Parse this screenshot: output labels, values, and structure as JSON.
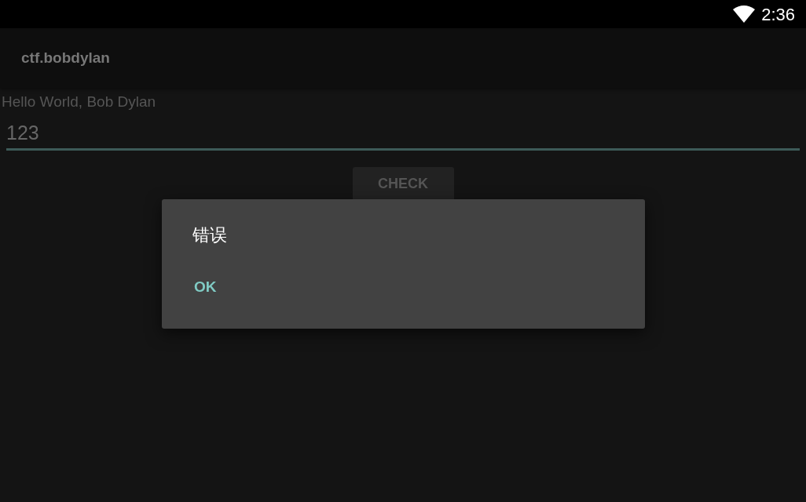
{
  "status_bar": {
    "time": "2:36"
  },
  "app_bar": {
    "title": "ctf.bobdylan"
  },
  "content": {
    "greeting": "Hello World, Bob Dylan",
    "input": {
      "value": "123"
    },
    "check_button": {
      "label": "CHECK"
    }
  },
  "dialog": {
    "title": "错误",
    "buttons": [
      "OK"
    ]
  }
}
